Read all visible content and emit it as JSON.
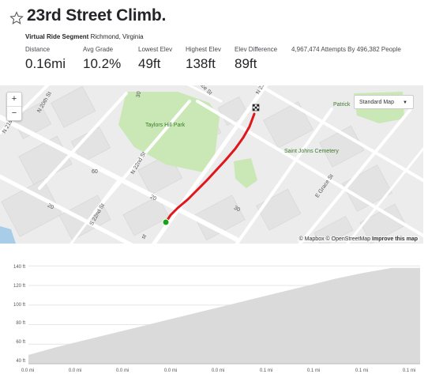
{
  "segment": {
    "title": "23rd Street Climb.",
    "type_label": "Virtual Ride Segment",
    "location": "Richmond, Virginia"
  },
  "stats": [
    {
      "label": "Distance",
      "value": "0.16mi"
    },
    {
      "label": "Avg Grade",
      "value": "10.2%"
    },
    {
      "label": "Lowest Elev",
      "value": "49ft"
    },
    {
      "label": "Highest Elev",
      "value": "138ft"
    },
    {
      "label": "Elev Difference",
      "value": "89ft"
    }
  ],
  "attempts": "4,967,474 Attempts By 496,382 People",
  "map": {
    "zoom_in": "+",
    "zoom_out": "−",
    "style_selector": "Standard Map",
    "attribution": {
      "mapbox": "© Mapbox",
      "osm": "© OpenStreetMap",
      "improve": "Improve this map"
    },
    "labels": {
      "taylors_hill_park": "Taylors Hill Park",
      "saint_johns_cemetery": "Saint Johns Cemetery",
      "patrick": "Patrick",
      "n20th": "N 20th St",
      "n22nd": "N 22nd St",
      "s22nd": "S 22nd St",
      "e_grace": "E Grace St",
      "grace": "race St",
      "n23rd": "N 23r",
      "n21st": "N 21st",
      "n30a": "30",
      "n30b": "30",
      "n20a": "20",
      "n20b": "20",
      "n60": "60",
      "st": "st"
    },
    "colors": {
      "route": "#e0161d",
      "start": "#1aa31a",
      "park": "#c9e8b5"
    }
  },
  "profile": {
    "y_ticks": [
      "140 ft",
      "120 ft",
      "100 ft",
      "80 ft",
      "60 ft",
      "40 ft"
    ],
    "x_ticks": [
      "0.0 mi",
      "0.0 mi",
      "0.0 mi",
      "0.0 mi",
      "0.0 mi",
      "0.1 mi",
      "0.1 mi",
      "0.1 mi",
      "0.1 mi"
    ],
    "elevation_range_ft": [
      40,
      145
    ],
    "distance_range_mi": [
      0,
      0.16
    ],
    "elevation_ft": [
      49,
      57,
      64,
      71,
      78,
      85,
      92,
      99,
      106,
      113,
      120,
      127,
      133,
      138,
      138
    ],
    "fill_color": "#dadada"
  }
}
